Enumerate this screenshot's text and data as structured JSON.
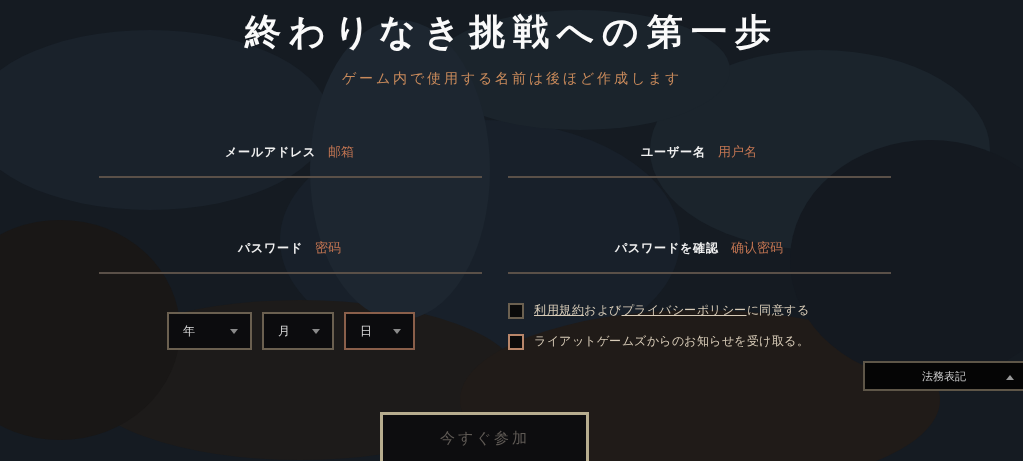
{
  "title": "終わりなき挑戦への第一歩",
  "subtitle": "ゲーム内で使用する名前は後ほど作成します",
  "fields": [
    {
      "label": "メールアドレス",
      "value": "邮箱"
    },
    {
      "label": "ユーザー名",
      "value": "用户名"
    },
    {
      "label": "パスワード",
      "value": "密码"
    },
    {
      "label": "パスワードを確認",
      "value": "确认密码"
    }
  ],
  "birth_date": [
    {
      "label": "年",
      "focused": false
    },
    {
      "label": "月",
      "focused": false
    },
    {
      "label": "日",
      "focused": true
    }
  ],
  "checkboxes": [
    {
      "checked": false,
      "focused": false,
      "parts": [
        {
          "kind": "link",
          "text": "利用規約"
        },
        {
          "kind": "text",
          "text": "および"
        },
        {
          "kind": "link",
          "text": "プライバシーポリシー"
        },
        {
          "kind": "text",
          "text": "に同意する"
        }
      ]
    },
    {
      "checked": false,
      "focused": true,
      "parts": [
        {
          "kind": "text",
          "text": "ライアットゲームズからのお知らせを受け取る。"
        }
      ]
    }
  ],
  "legal_button": {
    "label": "法務表記"
  },
  "submit_button": {
    "label": "今すぐ参加",
    "disabled": true
  }
}
